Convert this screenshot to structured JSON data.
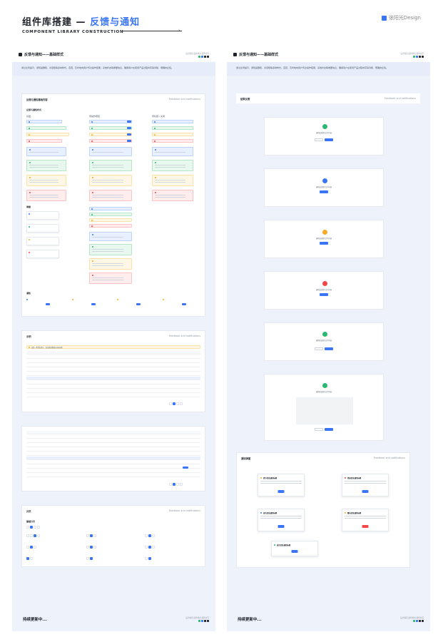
{
  "header": {
    "title_main": "组件库搭建 — ",
    "title_accent": "反馈与通知",
    "subtitle": "COMPONENT LIBRARY CONSTRUCTION",
    "brand": "张阳光Design"
  },
  "panel": {
    "title": "反馈与通知——基础样式",
    "meta": "设计规范  组件样式  组件交互",
    "description": "通过全局提示、通知提醒框、对话框等多种样式，直观、及时地向用户传达操作结果、系统状态等重要信息，确保用户在使用产品过程中获得清晰、明确的反馈。",
    "footer": "持续更新中..."
  },
  "left": {
    "card1": {
      "title": "反馈与通知基础内容",
      "subtitle": "Feedback and notifications",
      "sections": [
        "反馈与通知样式",
        "弹窗",
        "通知"
      ],
      "columns": [
        "基础",
        "带操作按钮",
        "带标题 / 关闭"
      ]
    },
    "card2": {
      "title": "示例",
      "subtitle": "Feedback and notifications",
      "banner": "这是一条警告提示，请注意查看相关内容详情"
    },
    "card4": {
      "title": "分页",
      "subtitle": "Feedback and notifications",
      "label": "基础分页"
    }
  },
  "right": {
    "card1": {
      "title": "结果反馈",
      "subtitle": "Feedback and notifications",
      "result_text": "操作成功提示文字内容"
    },
    "card2": {
      "title": "通知弹窗",
      "subtitle": "Feedback and notifications",
      "popups": [
        "提示信息通知标题",
        "错误信息通知标题",
        "成功信息通知标题",
        "警告信息通知标题",
        "成功信息通知标题"
      ]
    }
  },
  "colors": {
    "primary": "#3a75f7",
    "success": "#2bb673",
    "warning": "#f7a928",
    "error": "#f04848"
  }
}
